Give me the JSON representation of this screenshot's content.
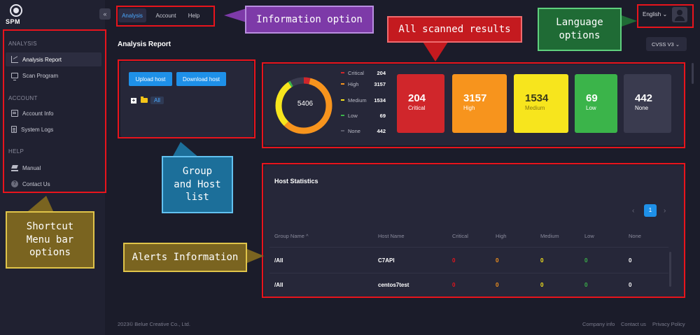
{
  "app": {
    "logo_text": "SPM"
  },
  "sidebar": {
    "sections": [
      {
        "label": "ANALYSIS",
        "items": [
          {
            "label": "Analysis Report",
            "icon": "chart-icon"
          },
          {
            "label": "Scan Program",
            "icon": "monitor-icon"
          }
        ]
      },
      {
        "label": "ACCOUNT",
        "items": [
          {
            "label": "Account Info",
            "icon": "id-card-icon"
          },
          {
            "label": "System Logs",
            "icon": "document-icon"
          }
        ]
      },
      {
        "label": "HELP",
        "items": [
          {
            "label": "Manual",
            "icon": "book-icon"
          },
          {
            "label": "Contact Us",
            "icon": "help-icon"
          }
        ]
      }
    ]
  },
  "topbar": {
    "collapse_glyph": "«",
    "tabs": [
      {
        "label": "Analysis",
        "active": true
      },
      {
        "label": "Account"
      },
      {
        "label": "Help"
      }
    ],
    "language": "English ⌄"
  },
  "page": {
    "title": "Analysis Report",
    "cvss_select": "CVSS V3 ⌄"
  },
  "group_panel": {
    "upload_label": "Upload host",
    "download_label": "Download host",
    "tree_expand": "+",
    "tree_root": "All"
  },
  "summary": {
    "total": "5406",
    "colors": {
      "critical": "#d0262b",
      "high": "#f7941d",
      "medium": "#f7e51d",
      "low": "#3bb44a",
      "none": "#3a3b4f"
    },
    "legend": [
      {
        "label": "Critical",
        "value": "204"
      },
      {
        "label": "High",
        "value": "3157"
      },
      {
        "label": "Medium",
        "value": "1534"
      },
      {
        "label": "Low",
        "value": "69"
      },
      {
        "label": "None",
        "value": "442"
      }
    ],
    "cards": [
      {
        "value": "204",
        "label": "Critical"
      },
      {
        "value": "3157",
        "label": "High"
      },
      {
        "value": "1534",
        "label": "Medium"
      },
      {
        "value": "69",
        "label": "Low"
      },
      {
        "value": "442",
        "label": "None"
      }
    ]
  },
  "host_stats": {
    "title": "Host Statistics",
    "pager": {
      "prev": "‹",
      "page": "1",
      "next": "›"
    },
    "columns": [
      "Group Name ^",
      "Host Name",
      "Critical",
      "High",
      "Medium",
      "Low",
      "None"
    ],
    "rows": [
      [
        "/All",
        "C7API",
        "0",
        "0",
        "0",
        "0",
        "0"
      ],
      [
        "/All",
        "centos7test",
        "0",
        "0",
        "0",
        "0",
        "0"
      ]
    ]
  },
  "footer": {
    "copyright": "2023© Belue Creative Co., Ltd.",
    "links": [
      "Company info",
      "Contact us",
      "Privacy Policy"
    ]
  },
  "annotations": {
    "information_option": "Information option",
    "all_scanned_results": "All scanned results",
    "language_options": "Language\noptions",
    "group_host_list": "Group\nand Host\nlist",
    "shortcut_menu": "Shortcut\nMenu bar\noptions",
    "alerts_information": "Alerts Information"
  }
}
